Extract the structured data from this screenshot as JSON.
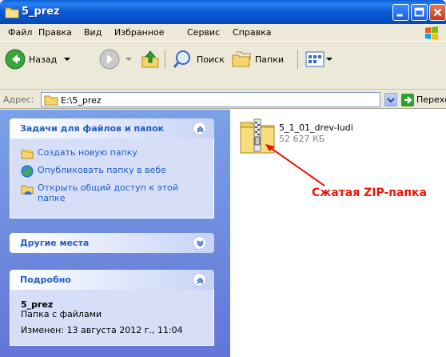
{
  "window": {
    "title": "5_prez"
  },
  "menu": [
    "Файл",
    "Правка",
    "Вид",
    "Избранное",
    "Сервис",
    "Справка"
  ],
  "toolbar": {
    "back_label": "Назад",
    "search_label": "Поиск",
    "folders_label": "Папки"
  },
  "address": {
    "label": "Адрес:",
    "path": "E:\\5_prez",
    "go_label": "Переход"
  },
  "tasks": {
    "title": "Задачи для файлов и папок",
    "items": [
      {
        "label": "Создать новую папку"
      },
      {
        "label": "Опубликовать папку в вебе"
      },
      {
        "label_line1": "Открыть общий доступ к этой",
        "label_line2": "папке"
      }
    ]
  },
  "other": {
    "title": "Другие места"
  },
  "details": {
    "title": "Подробно",
    "name": "5_prez",
    "type": "Папка с файлами",
    "modified": "Изменен: 13 августа 2012 г., 11:04"
  },
  "file": {
    "name": "5_1_01_drev-ludi",
    "size": "52 627 КБ"
  },
  "annotation": "Сжатая ZIP-папка",
  "colors": {
    "titlebar": "#0c5ad6",
    "panel_title": "#215dc6",
    "annotation": "#e8160c"
  }
}
